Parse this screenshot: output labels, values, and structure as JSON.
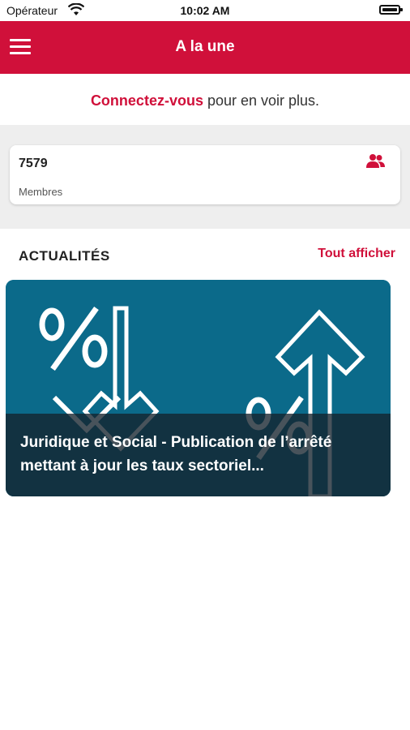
{
  "status_bar": {
    "carrier": "Opérateur",
    "time": "10:02 AM"
  },
  "header": {
    "title": "A la une",
    "menu_icon": "hamburger-menu-icon",
    "background_color": "#d0103a"
  },
  "connect": {
    "link_text": "Connectez-vous",
    "rest_text": " pour en voir plus."
  },
  "members": {
    "count": "7579",
    "label": "Membres",
    "icon": "members-icon"
  },
  "news": {
    "section_title": "ACTUALITÉS",
    "see_all_label": "Tout afficher",
    "items": [
      {
        "title": "Juridique et Social - Publication de l’arrêté mettant à jour les taux sectoriel...",
        "image_icon": "percent-down-up-arrows-illustration"
      }
    ]
  },
  "colors": {
    "accent": "#d0103a",
    "card_image_bg": "#0b6a8a"
  }
}
